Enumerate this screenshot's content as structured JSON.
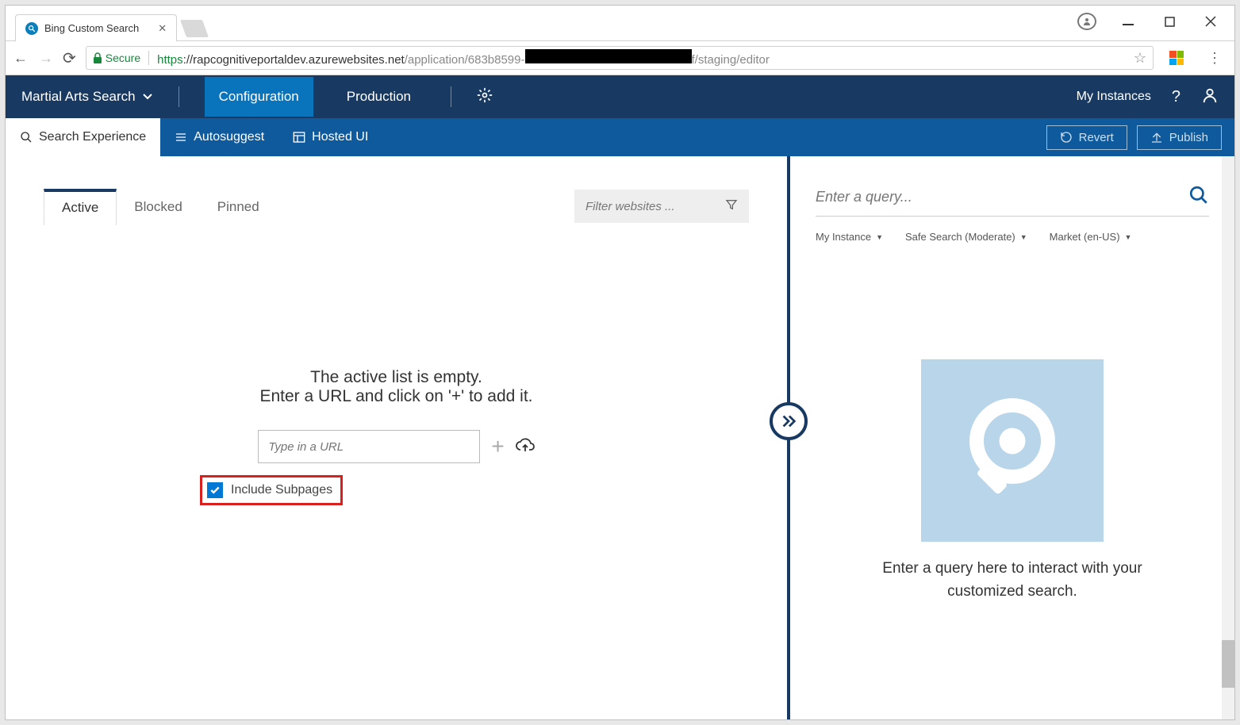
{
  "browser": {
    "tab_title": "Bing Custom Search",
    "url_proto": "https",
    "url_host": "://rapcognitiveportaldev.azurewebsites.net",
    "url_path_pre": "/application/683b8599-",
    "url_path_post": "f/staging/editor",
    "secure_label": "Secure"
  },
  "header": {
    "app_name": "Martial Arts Search",
    "nav": {
      "configuration": "Configuration",
      "production": "Production"
    },
    "my_instances": "My Instances"
  },
  "subheader": {
    "tabs": {
      "search_exp": "Search Experience",
      "autosuggest": "Autosuggest",
      "hosted_ui": "Hosted UI"
    },
    "revert": "Revert",
    "publish": "Publish"
  },
  "left": {
    "tabs": {
      "active": "Active",
      "blocked": "Blocked",
      "pinned": "Pinned"
    },
    "filter_placeholder": "Filter websites ...",
    "empty_line1": "The active list is empty.",
    "empty_line2": "Enter a URL and click on '+' to add it.",
    "url_placeholder": "Type in a URL",
    "include_subpages": "Include Subpages"
  },
  "right": {
    "query_placeholder": "Enter a query...",
    "filters": {
      "instance": "My Instance",
      "safesearch": "Safe Search (Moderate)",
      "market": "Market (en-US)"
    },
    "placeholder_text": "Enter a query here to interact with your customized search."
  }
}
